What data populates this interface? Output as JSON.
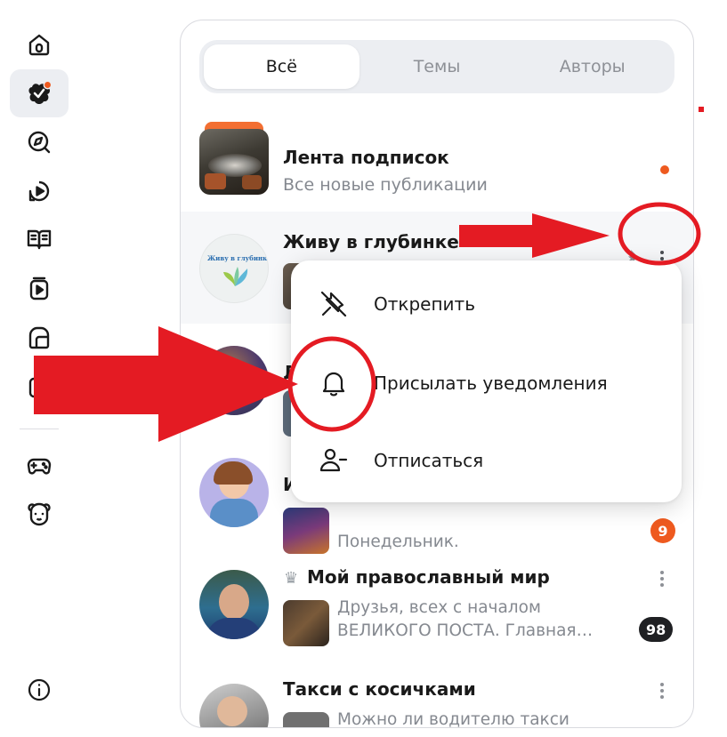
{
  "sidebar": {
    "items": [
      {
        "icon": "home-icon"
      },
      {
        "icon": "subscriptions-icon",
        "active": true,
        "has_dot": true
      },
      {
        "icon": "compass-icon"
      },
      {
        "icon": "play-circle-icon"
      },
      {
        "icon": "book-icon"
      },
      {
        "icon": "video-stack-icon"
      },
      {
        "icon": "shop-icon"
      },
      {
        "icon": "partial-icon"
      },
      {
        "icon": "gamepad-icon"
      },
      {
        "icon": "bear-icon"
      },
      {
        "icon": "info-icon"
      }
    ]
  },
  "tabs": [
    {
      "label": "Всё",
      "active": true
    },
    {
      "label": "Темы",
      "active": false
    },
    {
      "label": "Авторы",
      "active": false
    }
  ],
  "feed": {
    "items": [
      {
        "title": "Лента подписок",
        "subtitle": "Все новые публикации",
        "has_dot": true
      },
      {
        "title": "Живу в глубинке",
        "avatar_text": "Живу в глубинке"
      },
      {
        "title_fragment": "Д"
      },
      {
        "title_fragment": "И",
        "preview_line2": "Понедельник.",
        "badge": "9"
      },
      {
        "crown": "♛",
        "title": "Мой православный мир",
        "preview_line1": "Друзья, всех с началом",
        "preview_line2": "ВЕЛИКОГО ПОСТА. Главная…",
        "badge": "98"
      },
      {
        "title": "Такси с косичками",
        "preview_line1": "Можно ли водителю такси"
      }
    ]
  },
  "menu": {
    "items": [
      {
        "label": "Открепить",
        "icon": "unpin-icon"
      },
      {
        "label": "Присылать уведомления",
        "icon": "bell-icon"
      },
      {
        "label": "Отписаться",
        "icon": "unsubscribe-icon"
      }
    ]
  },
  "colors": {
    "accent": "#ee5a1f",
    "annotation_red": "#e41b23",
    "muted_text": "#858990",
    "badge_dark": "#1f2023"
  }
}
